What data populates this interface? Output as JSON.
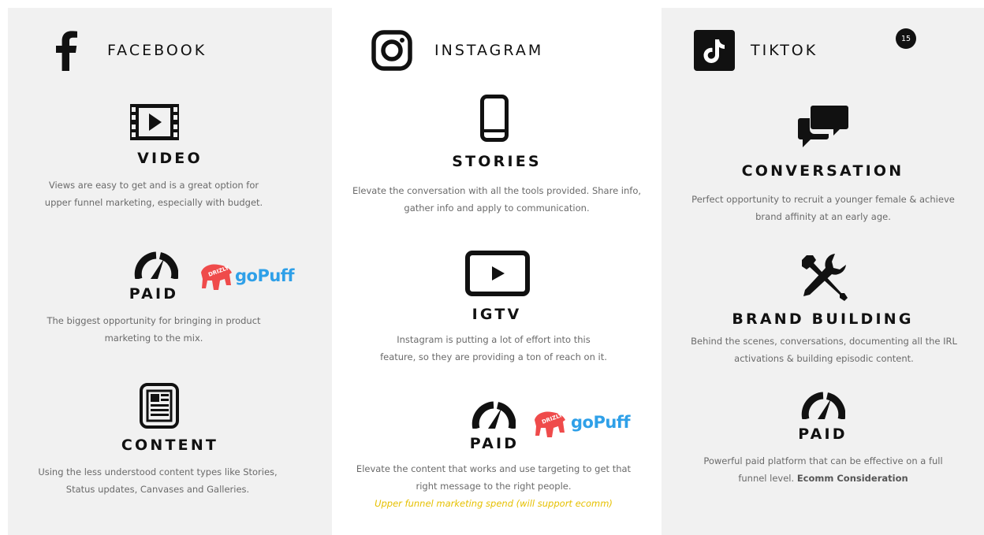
{
  "badge": "15",
  "columns": {
    "facebook": {
      "name": "FACEBOOK",
      "sections": {
        "video": {
          "title": "VIDEO",
          "desc": "Views are easy to get and is a great option for upper funnel marketing, especially with budget."
        },
        "paid": {
          "title": "PAID",
          "desc": "The biggest opportunity for bringing in product marketing to the mix."
        },
        "content": {
          "title": "CONTENT",
          "desc": "Using the less understood content types like Stories, Status updates, Canvases and Galleries."
        }
      }
    },
    "instagram": {
      "name": "INSTAGRAM",
      "sections": {
        "stories": {
          "title": "STORIES",
          "desc": "Elevate the conversation with all the tools provided. Share info, gather info and apply to communication."
        },
        "igtv": {
          "title": "IGTV",
          "desc": "Instagram is putting a lot of effort into this feature, so they are providing a ton of reach on it."
        },
        "paid": {
          "title": "PAID",
          "desc": "Elevate the content that works and use targeting to get that right message to the right people.",
          "note": "Upper funnel marketing spend (will support ecomm)"
        }
      }
    },
    "tiktok": {
      "name": "TIKTOK",
      "sections": {
        "conversation": {
          "title": "CONVERSATION",
          "desc": "Perfect opportunity to recruit a younger female & achieve brand affinity at an early age."
        },
        "brand_building": {
          "title": "BRAND BUILDING",
          "desc": "Behind the scenes, conversations, documenting all the IRL activations & building episodic content."
        },
        "paid": {
          "title": "PAID",
          "desc": "Powerful paid platform that can be effective on a full funnel level.",
          "desc_bold": "Ecomm Consideration"
        }
      }
    }
  },
  "logos": {
    "drizly": "DRIZLY",
    "gopuff": "goPuff"
  },
  "colors": {
    "panel": "#f1f1f1",
    "text": "#6a6a6a",
    "note": "#e6c000",
    "drizly": "#ef4b4b",
    "gopuff": "#2fa0e8"
  }
}
